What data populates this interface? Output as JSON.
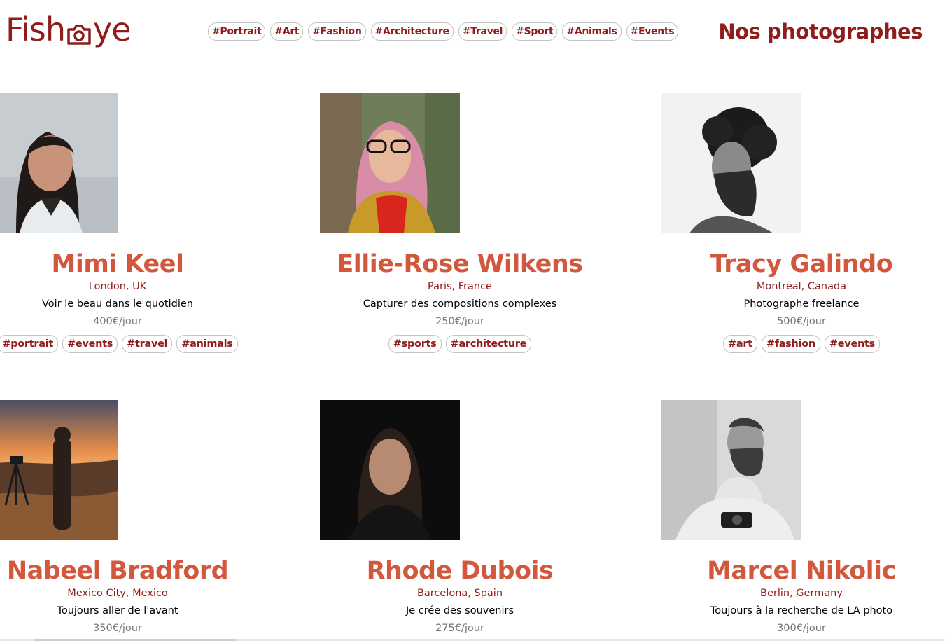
{
  "header": {
    "logo_prefix": "Fish",
    "logo_suffix": "ye",
    "logo_icon": "camera-icon",
    "page_title": "Nos photographes",
    "nav_tags": [
      "#Portrait",
      "#Art",
      "#Fashion",
      "#Architecture",
      "#Travel",
      "#Sport",
      "#Animals",
      "#Events"
    ]
  },
  "colors": {
    "brand": "#901C1C",
    "name": "#D3573C",
    "price": "#757575"
  },
  "photographers": [
    {
      "name": "Mimi Keel",
      "location": "London, UK",
      "tagline": "Voir le beau dans le quotidien",
      "price": "400€/jour",
      "tags": [
        "#portrait",
        "#events",
        "#travel",
        "#animals"
      ]
    },
    {
      "name": "Ellie-Rose Wilkens",
      "location": "Paris, France",
      "tagline": "Capturer des compositions complexes",
      "price": "250€/jour",
      "tags": [
        "#sports",
        "#architecture"
      ]
    },
    {
      "name": "Tracy Galindo",
      "location": "Montreal, Canada",
      "tagline": "Photographe freelance",
      "price": "500€/jour",
      "tags": [
        "#art",
        "#fashion",
        "#events"
      ]
    },
    {
      "name": "Nabeel Bradford",
      "location": "Mexico City, Mexico",
      "tagline": "Toujours aller de l'avant",
      "price": "350€/jour",
      "tags": []
    },
    {
      "name": "Rhode Dubois",
      "location": "Barcelona, Spain",
      "tagline": "Je crée des souvenirs",
      "price": "275€/jour",
      "tags": []
    },
    {
      "name": "Marcel Nikolic",
      "location": "Berlin, Germany",
      "tagline": "Toujours à la recherche de LA photo",
      "price": "300€/jour",
      "tags": []
    }
  ]
}
